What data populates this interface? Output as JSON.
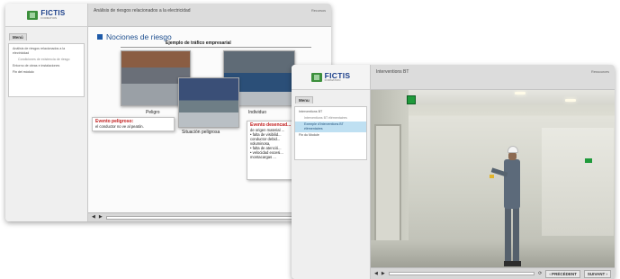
{
  "window1": {
    "logo": {
      "name": "FICTIS",
      "tagline": "FORMATION"
    },
    "header_title": "Análisis de riesgos relacionados a la electricidad",
    "resources_label": "Recursos",
    "menu_tab": "Menú",
    "menu_items": [
      {
        "label": "Análisis de riesgos relacionados a la electricidad"
      },
      {
        "label": "Condiciones de existencia de riesgo"
      },
      {
        "label": "Entorno de obras e instalaciones"
      },
      {
        "label": "Fin del módulo"
      }
    ],
    "section_title": "Nociones de riesgo",
    "panel_title": "Ejemplo de tráfico empresarial",
    "scene_labels": {
      "peligro": "Peligro",
      "individuo": "Individuo",
      "situacion": "Situación peligrosa"
    },
    "callout_left": {
      "title": "Evento peligroso:",
      "text": "el conductor no ve al peatón."
    },
    "callout_right": {
      "title": "Evento desencad...",
      "text": "de origen material ...",
      "bullets": [
        "falta de visibilid... conductor debid... voluminosa,",
        "falta de atenció...",
        "velocidad excesi... montacargas ..."
      ]
    },
    "controls": {
      "sound": "◀",
      "play": "▶",
      "refresh": "⟳",
      "prev": "‹ A"
    }
  },
  "window2": {
    "logo": {
      "name": "FICTIS",
      "tagline": "FORMATION"
    },
    "header_title": "Interventions BT",
    "resources_label": "Ressources",
    "menu_tab": "Menu",
    "menu_items": [
      {
        "label": "Interventions BT"
      },
      {
        "label": "Interventions BT élémentaires"
      },
      {
        "label": "Exemple d'Interventions BT élémentaires"
      },
      {
        "label": "Fin du Module"
      }
    ],
    "controls": {
      "sound": "◀",
      "play": "▶",
      "refresh": "⟳",
      "prev": "‹ PRÉCÉDENT",
      "next": "SUIVANT ›"
    }
  },
  "colors": {
    "accent_blue": "#1e5aa8",
    "danger_red": "#c01818",
    "active_item": "#bfe0f2",
    "logo_green": "#3c8f3c"
  }
}
